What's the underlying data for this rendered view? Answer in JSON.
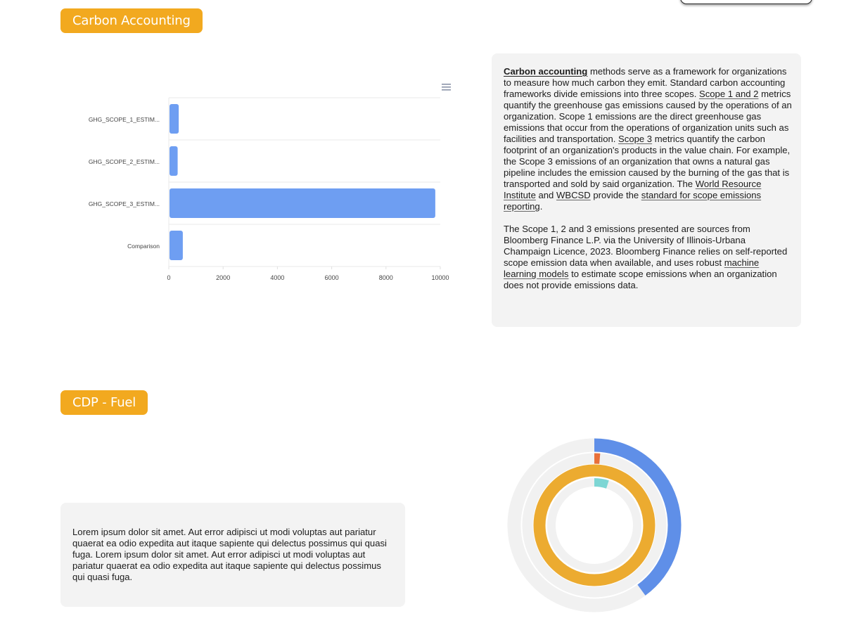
{
  "top_button": {
    "label": ""
  },
  "sections": {
    "carbon": {
      "title": "Carbon Accounting"
    },
    "cdp": {
      "title": "CDP - Fuel"
    }
  },
  "chart_menu": {
    "icon": "hamburger-menu-icon"
  },
  "carbon_text": {
    "p1": [
      {
        "text": "Carbon accounting",
        "link": true,
        "bold": true
      },
      {
        "text": " methods serve as a framework for organizations to measure how much carbon they emit. Standard carbon accounting frameworks divide emissions into three scopes. "
      },
      {
        "text": "Scope 1 and 2",
        "link": true
      },
      {
        "text": " metrics quantify the greenhouse gas emissions caused by the operations of an organization. Scope 1 emissions are the direct greenhouse gas emissions that occur from the operations of organization units such as facilities and transportation. "
      },
      {
        "text": "Scope 3",
        "link": true
      },
      {
        "text": " metrics quantify the carbon footprint of an organization's products in the value chain. For example, the Scope 3 emissions of an organization that owns a natural gas pipeline includes the emission caused by the burning of the gas that is transported and sold by said organization. The "
      },
      {
        "text": "World Resource Institute",
        "link": true
      },
      {
        "text": " and "
      },
      {
        "text": "WBCSD",
        "link": true
      },
      {
        "text": " provide the "
      },
      {
        "text": "standard for scope emissions reporting",
        "link": true
      },
      {
        "text": "."
      }
    ],
    "p2": [
      {
        "text": "The Scope 1, 2 and 3 emissions presented are sources from Bloomberg Finance L.P. via the University of Illinois-Urbana Champaign Licence, 2023. Bloomberg Finance relies on self-reported scope emission data when available, and uses robust "
      },
      {
        "text": "machine learning models",
        "link": true
      },
      {
        "text": " to estimate scope emissions when an organization does not provide emissions data."
      }
    ]
  },
  "cdp_text": "Lorem ipsum dolor sit amet. Aut error adipisci ut modi voluptas aut pariatur quaerat ea odio expedita aut itaque sapiente qui delectus possimus qui quasi fuga. Lorem ipsum dolor sit amet. Aut error adipisci ut modi voluptas aut pariatur quaerat ea odio expedita aut itaque sapiente qui delectus possimus qui quasi fuga.",
  "chart_data": [
    {
      "type": "bar",
      "orientation": "horizontal",
      "title": "",
      "xlabel": "",
      "ylabel": "",
      "categories": [
        "GHG_SCOPE_1_ESTIM...",
        "GHG_SCOPE_2_ESTIM...",
        "GHG_SCOPE_3_ESTIM...",
        "Comparison"
      ],
      "values": [
        340,
        300,
        9790,
        490
      ],
      "xlim": [
        0,
        10000
      ],
      "xticks": [
        0,
        2000,
        4000,
        6000,
        8000,
        10000
      ],
      "grid": true,
      "color": "#6e9ef2"
    },
    {
      "type": "radialBar",
      "title": "",
      "series": [
        {
          "name": "ring-1",
          "percent": 40,
          "color": "#5f8fe8"
        },
        {
          "name": "ring-2",
          "percent": 1.3,
          "color": "#e8703a"
        },
        {
          "name": "ring-3",
          "percent": 100,
          "color": "#ecab30"
        },
        {
          "name": "ring-4",
          "percent": 5,
          "color": "#7dd6d4"
        }
      ],
      "track_color": "#f1f1f1"
    }
  ]
}
